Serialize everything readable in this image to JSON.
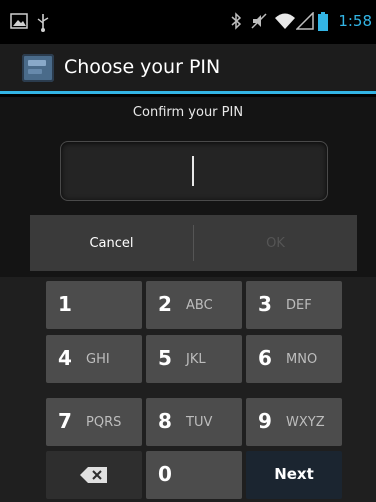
{
  "status_bar": {
    "time": "1:58",
    "icons": [
      "gallery-icon",
      "usb-icon",
      "bluetooth-icon",
      "mute-icon",
      "wifi-icon",
      "signal-icon",
      "battery-icon"
    ],
    "accent": "#33b5e5"
  },
  "action_bar": {
    "title": "Choose your PIN",
    "icon": "settings-app-icon"
  },
  "pin_entry": {
    "prompt": "Confirm your PIN",
    "value": ""
  },
  "buttons": {
    "cancel_label": "Cancel",
    "ok_label": "OK",
    "ok_enabled": false
  },
  "keypad": {
    "keys": [
      {
        "num": "1",
        "letters": ""
      },
      {
        "num": "2",
        "letters": "ABC"
      },
      {
        "num": "3",
        "letters": "DEF"
      },
      {
        "num": "4",
        "letters": "GHI"
      },
      {
        "num": "5",
        "letters": "JKL"
      },
      {
        "num": "6",
        "letters": "MNO"
      },
      {
        "num": "7",
        "letters": "PQRS"
      },
      {
        "num": "8",
        "letters": "TUV"
      },
      {
        "num": "9",
        "letters": "WXYZ"
      },
      {
        "num": "0",
        "letters": ""
      }
    ],
    "delete_icon": "backspace-icon",
    "next_label": "Next"
  }
}
